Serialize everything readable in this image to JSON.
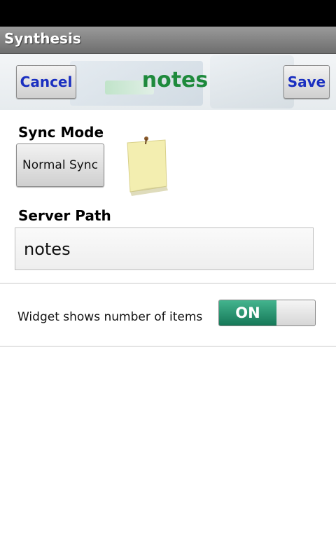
{
  "app": {
    "title": "Synthesis"
  },
  "header": {
    "cancel_label": "Cancel",
    "title": "notes",
    "save_label": "Save"
  },
  "sync": {
    "label": "Sync Mode",
    "button_label": "Normal Sync"
  },
  "server_path": {
    "label": "Server Path",
    "value": "notes"
  },
  "widget": {
    "label": "Widget shows number of items",
    "toggle_label": "ON",
    "enabled": true
  },
  "colors": {
    "accent_green": "#1e8a3c",
    "button_text_blue": "#1a2fc0",
    "toggle_on": "#2a9a72"
  },
  "icons": {
    "note": "sticky-note-icon"
  }
}
